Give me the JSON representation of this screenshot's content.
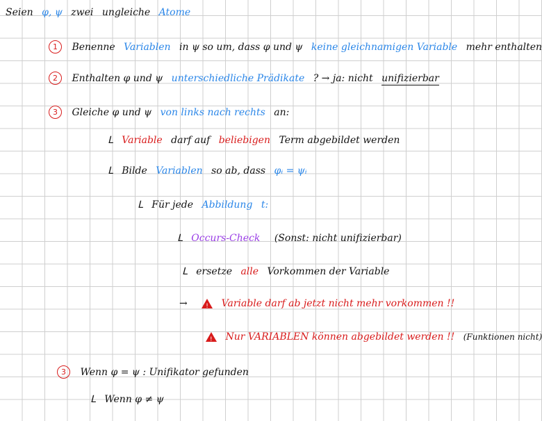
{
  "lines": {
    "l1": {
      "a": "Seien",
      "b": "φ, ψ",
      "c": "zwei",
      "d": "ungleiche",
      "e": "Atome"
    },
    "l2": {
      "num": "1",
      "a": "Benenne",
      "b": "Variablen",
      "c": "in ψ so um, dass φ und ψ",
      "d": "keine gleichnamigen Variable",
      "e": "mehr enthalten"
    },
    "l3": {
      "num": "2",
      "a": "Enthalten φ und ψ",
      "b": "unterschiedliche Prädikate",
      "c": "? → ja: nicht",
      "d": "unifizierbar"
    },
    "l4": {
      "num": "3",
      "a": "Gleiche φ und ψ",
      "b": "von links nach rechts",
      "c": "an:"
    },
    "l5": {
      "lead": "ᒪ",
      "a": "Variable",
      "b": "darf auf",
      "c": "beliebigen",
      "d": "Term abgebildet werden"
    },
    "l6": {
      "lead": "ᒪ",
      "a": "Bilde",
      "b": "Variablen",
      "c": "so ab, dass",
      "d": "φᵢ = ψᵢ"
    },
    "l7": {
      "lead": "ᒪ",
      "a": "Für jede",
      "b": "Abbildung",
      "c": "t:"
    },
    "l8": {
      "lead": "ᒪ",
      "a": "Occurs-Check",
      "b": "(Sonst: nicht unifizierbar)"
    },
    "l9": {
      "lead": "ᒪ",
      "a": "ersetze",
      "b": "alle",
      "c": "Vorkommen der Variable"
    },
    "l10": {
      "lead": "→",
      "a": "Variable darf ab jetzt nicht mehr vorkommen !!"
    },
    "l11": {
      "a": "Nur VARIABLEN können abgebildet werden !!",
      "b": "(Funktionen nicht)"
    },
    "l12": {
      "num": "3",
      "a": "Wenn φ = ψ : Unifikator gefunden"
    },
    "l13": {
      "lead": "ᒪ",
      "a": "Wenn φ ≠ ψ"
    }
  },
  "colors": {
    "ink": "#111111",
    "blue": "#2a86e8",
    "red": "#d81b1b",
    "purple": "#9a3ee6",
    "grid": "#cfcfcf"
  }
}
